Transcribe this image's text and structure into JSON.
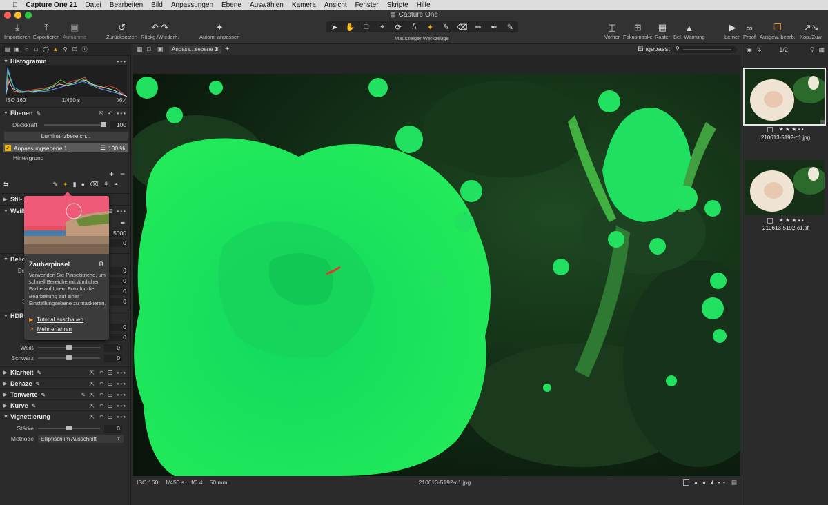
{
  "menubar": {
    "apple": "",
    "app_name": "Capture One 21",
    "items": [
      "Datei",
      "Bearbeiten",
      "Bild",
      "Anpassungen",
      "Ebene",
      "Auswählen",
      "Kamera",
      "Ansicht",
      "Fenster",
      "Skripte",
      "Hilfe"
    ]
  },
  "window": {
    "title": "Capture One"
  },
  "toolbar": {
    "import": "Importieren",
    "export": "Exportieren",
    "capture": "Aufnahme",
    "reset": "Zurücksetzen",
    "undo_redo": "Rückg./Wiederh.",
    "auto_adjust": "Autom. anpassen",
    "cursor_tools": "Mauszeiger Werkzeuge",
    "before": "Vorher",
    "focus_mask": "Fokusmaske",
    "grid": "Raster",
    "exposure_warning": "Bel.-Warnung",
    "learn": "Lernen",
    "proof": "Proof",
    "edit_selected": "Ausgew. bearb.",
    "copy_apply": "Kop./Zuw."
  },
  "viewer": {
    "layer_select": "Anpass...sebene 1",
    "zoom": "Eingepasst",
    "counter": "1/2"
  },
  "histogram": {
    "title": "Histogramm",
    "iso": "ISO 160",
    "shutter": "1/450 s",
    "aperture": "f/6.4"
  },
  "layers": {
    "title": "Ebenen",
    "opacity_label": "Deckkraft",
    "opacity_value": "100",
    "opacity_fraction": 1.0,
    "luma_button": "Luminanzbereich...",
    "layer1_name": "Anpassungsebene 1",
    "layer1_opacity": "100 %",
    "background": "Hintergrund"
  },
  "sections": {
    "style": "Stil-…",
    "wb": "Weiß",
    "exposure": "Belic",
    "hdr": "HDR",
    "clarity": "Klarheit",
    "dehaze": "Dehaze",
    "tone": "Tonwerte",
    "curve": "Kurve",
    "vignette": "Vignettierung"
  },
  "wb": {
    "row1_label": "M",
    "row2_label": "K",
    "row2_value": "5000",
    "row3_label": "Fi",
    "row3_value": "0"
  },
  "exposure": {
    "rows": [
      {
        "label": "Belich",
        "value": "0"
      },
      {
        "label": "Kor",
        "value": "0"
      },
      {
        "label": "Hell",
        "value": "0"
      },
      {
        "label": "Sätti",
        "value": "0"
      }
    ]
  },
  "hdr": {
    "rows": [
      {
        "label": "Li",
        "value": "0"
      },
      {
        "label": "T",
        "value": "0"
      },
      {
        "label": "Weiß",
        "value": "0"
      },
      {
        "label": "Schwarz",
        "value": "0"
      }
    ]
  },
  "vignette": {
    "strength_label": "Stärke",
    "strength_value": "0",
    "method_label": "Methode",
    "method_value": "Elliptisch im Ausschnitt"
  },
  "tooltip": {
    "name": "Zauberpinsel",
    "shortcut": "B",
    "description": "Verwenden Sie Pinselstriche, um schnell Bereiche mit ähnlicher Farbe auf Ihrem Foto für die Bearbeitung auf einer Einstellungsebene zu maskieren.",
    "tutorial": "Tutorial anschauen",
    "more": "Mehr erfahren"
  },
  "statusbar": {
    "iso": "ISO 160",
    "shutter": "1/450 s",
    "aperture": "f/6.4",
    "focal": "50 mm",
    "filename": "210613-5192-c1.jpg",
    "stars": "★ ★ ★ • •"
  },
  "browser": {
    "thumbs": [
      {
        "filename": "210613-5192-c1.jpg",
        "stars": "★ ★ ★ • •"
      },
      {
        "filename": "210613-5192-c1.tif",
        "stars": "★ ★ ★ • •"
      }
    ]
  },
  "colors": {
    "mask_green": "#22e060",
    "accent": "#f0a020"
  }
}
